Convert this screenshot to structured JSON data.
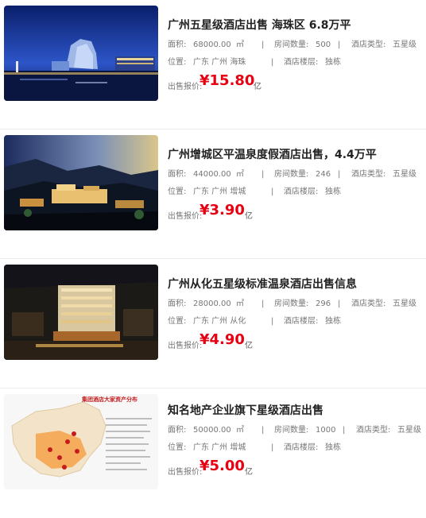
{
  "listings": [
    {
      "title": "广州五星级酒店出售 海珠区 6.8万平",
      "area_label": "面积:",
      "area": "68000.00",
      "area_unit": "㎡",
      "sep1": "|",
      "rooms_label": "房间数量:",
      "rooms": "500",
      "sep2": "|",
      "type_label": "酒店类型:",
      "type": "五星级",
      "loc_label": "位置:",
      "location": "广东 广州 海珠",
      "sep3": "|",
      "floor_label": "酒店楼层:",
      "floor": "独栋",
      "price_label": "出售报价:",
      "price": "¥15.80",
      "price_unit": "亿"
    },
    {
      "title": "广州增城区平温泉度假酒店出售，4.4万平",
      "area_label": "面积:",
      "area": "44000.00",
      "area_unit": "㎡",
      "sep1": "|",
      "rooms_label": "房间数量:",
      "rooms": "246",
      "sep2": "|",
      "type_label": "酒店类型:",
      "type": "五星级",
      "loc_label": "位置:",
      "location": "广东 广州 增城",
      "sep3": "|",
      "floor_label": "酒店楼层:",
      "floor": "独栋",
      "price_label": "出售报价:",
      "price": "¥3.90",
      "price_unit": "亿"
    },
    {
      "title": "广州从化五星级标准温泉酒店出售信息",
      "area_label": "面积:",
      "area": "28000.00",
      "area_unit": "㎡",
      "sep1": "|",
      "rooms_label": "房间数量:",
      "rooms": "296",
      "sep2": "|",
      "type_label": "酒店类型:",
      "type": "五星级",
      "loc_label": "位置:",
      "location": "广东 广州 从化",
      "sep3": "|",
      "floor_label": "酒店楼层:",
      "floor": "独栋",
      "price_label": "出售报价:",
      "price": "¥4.90",
      "price_unit": "亿"
    },
    {
      "title": "知名地产企业旗下星级酒店出售",
      "area_label": "面积:",
      "area": "50000.00",
      "area_unit": "㎡",
      "sep1": "|",
      "rooms_label": "房间数量:",
      "rooms": "1000",
      "sep2": "|",
      "type_label": "酒店类型:",
      "type": "五星级",
      "loc_label": "位置:",
      "location": "广东 广州 增城",
      "sep3": "|",
      "floor_label": "酒店楼层:",
      "floor": "独栋",
      "price_label": "出售报价:",
      "price": "¥5.00",
      "price_unit": "亿",
      "map_caption": "集团酒店大家资产分布"
    }
  ],
  "colors": {
    "price": "#e60012",
    "divider": "#ececec"
  }
}
